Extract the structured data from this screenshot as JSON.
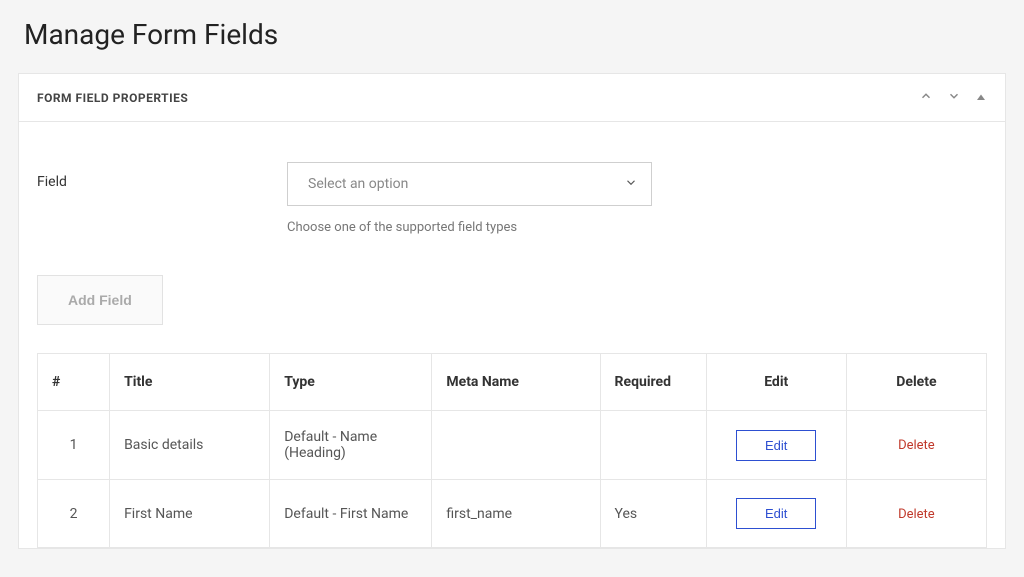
{
  "page": {
    "title": "Manage Form Fields"
  },
  "panel": {
    "title": "FORM FIELD PROPERTIES"
  },
  "field_select": {
    "label": "Field",
    "placeholder": "Select an option",
    "help": "Choose one of the supported field types"
  },
  "buttons": {
    "add_field": "Add Field",
    "edit": "Edit",
    "delete": "Delete"
  },
  "table": {
    "headers": {
      "index": "#",
      "title": "Title",
      "type": "Type",
      "meta": "Meta Name",
      "required": "Required",
      "edit": "Edit",
      "delete": "Delete"
    },
    "rows": [
      {
        "index": "1",
        "title": "Basic details",
        "type": "Default - Name (Heading)",
        "meta": "",
        "required": ""
      },
      {
        "index": "2",
        "title": "First Name",
        "type": "Default - First Name",
        "meta": "first_name",
        "required": "Yes"
      }
    ]
  }
}
